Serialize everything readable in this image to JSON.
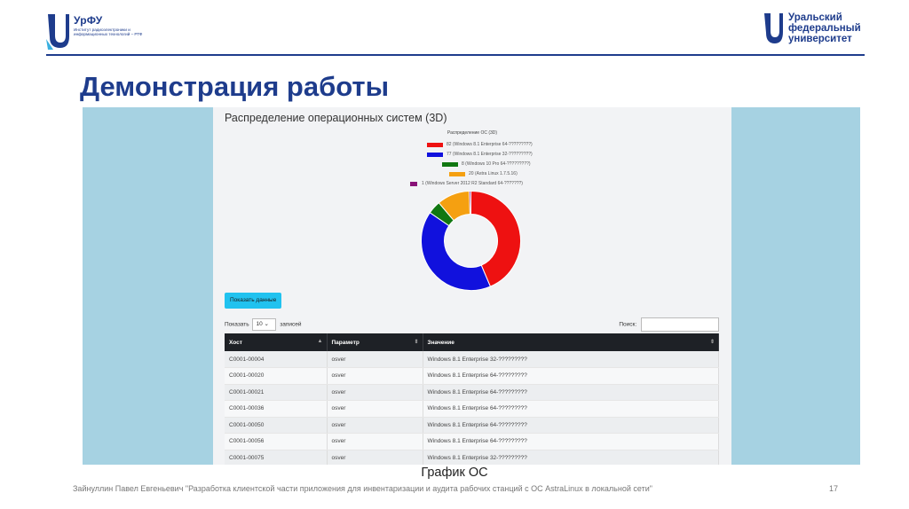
{
  "header": {
    "left_logo": {
      "brand": "УрФУ",
      "sub": "Институт радиоэлектроники и информационных технологий – РТФ"
    },
    "right_logo": {
      "lines": [
        "Уральский",
        "федеральный",
        "университет"
      ]
    },
    "brand_color": "#1e3c8c"
  },
  "slide": {
    "title": "Демонстрация работы",
    "caption": "График ОС",
    "footer": "Зайнуллин Павел Евгеньевич \"Разработка клиентской части приложения для инвентаризации и аудита рабочих станций с ОС AstraLinux в локальной сети\"",
    "page_number": "17"
  },
  "app": {
    "heading": "Распределение операционных систем (3D)",
    "show_button": "Показать данные",
    "length_prefix": "Показать",
    "length_value": "10",
    "length_suffix": "записей",
    "search_label": "Поиск:",
    "search_value": "",
    "columns": [
      "Хост",
      "Параметр",
      "Значение"
    ],
    "rows": [
      [
        "C0001-00004",
        "osver",
        "Windows 8.1 Enterprise 32-?????????"
      ],
      [
        "C0001-00020",
        "osver",
        "Windows 8.1 Enterprise 64-?????????"
      ],
      [
        "C0001-00021",
        "osver",
        "Windows 8.1 Enterprise 64-?????????"
      ],
      [
        "C0001-00036",
        "osver",
        "Windows 8.1 Enterprise 64-?????????"
      ],
      [
        "C0001-00050",
        "osver",
        "Windows 8.1 Enterprise 64-?????????"
      ],
      [
        "C0001-00056",
        "osver",
        "Windows 8.1 Enterprise 64-?????????"
      ],
      [
        "C0001-00075",
        "osver",
        "Windows 8.1 Enterprise 32-?????????"
      ]
    ]
  },
  "chart_data": {
    "type": "pie",
    "title": "Распределение ОС (3D)",
    "legend_placement": "top",
    "series": [
      {
        "name": "82 (Windows 8.1 Enterprise 64-?????????)",
        "value": 82,
        "color": "#ee1111"
      },
      {
        "name": "77 (Windows 8.1 Enterprise 32-?????????)",
        "value": 77,
        "color": "#1111dd"
      },
      {
        "name": "8 (Windows 10 Pro 64-?????????)",
        "value": 8,
        "color": "#117711"
      },
      {
        "name": "20 (Astra Linux 1.7.5.16)",
        "value": 20,
        "color": "#f5a011"
      },
      {
        "name": "1 (Windows Server 2012 R2 Standard 64-???????)",
        "value": 1,
        "color": "#881177"
      }
    ]
  }
}
